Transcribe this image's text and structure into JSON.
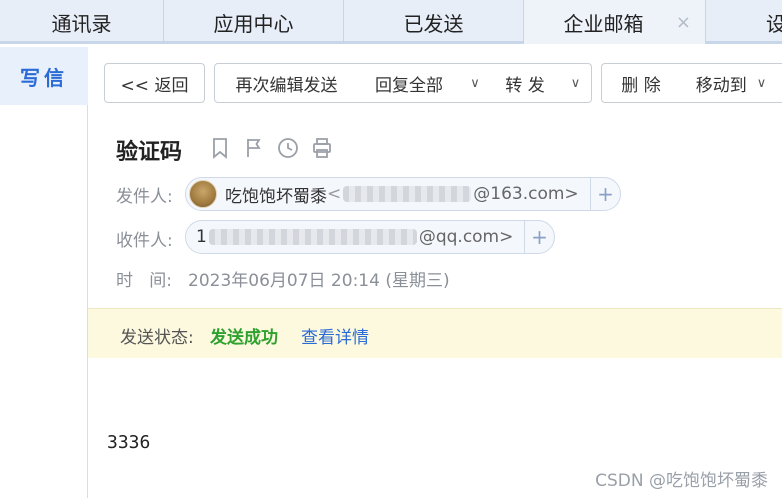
{
  "tabs": [
    {
      "label": "通讯录"
    },
    {
      "label": "应用中心"
    },
    {
      "label": "已发送"
    },
    {
      "label": "企业邮箱",
      "close": "×"
    },
    {
      "label": "设"
    }
  ],
  "sidebar": {
    "compose_label": "写信"
  },
  "toolbar": {
    "back_label": "<< 返回",
    "edit_resend_label": "再次编辑发送",
    "reply_all_label": "回复全部",
    "forward_label": "转 发",
    "delete_label": "删 除",
    "move_label": "移动到",
    "caret": "∨"
  },
  "mail": {
    "subject": "验证码",
    "from_label": "发件人:",
    "sender_name": "吃饱饱坏蜀黍",
    "sender_lt": "<",
    "sender_domain": "@163.com>",
    "to_label": "收件人:",
    "recipient_prefix": "1",
    "recipient_domain": "@qq.com>",
    "plus": "+",
    "time_label": "时   间:",
    "date": "2023年06月07日 20:14 (星期三)",
    "body": "3336"
  },
  "status": {
    "label": "发送状态:",
    "value": "发送成功",
    "link": "查看详情"
  },
  "watermark": "CSDN @吃饱饱坏蜀黍"
}
